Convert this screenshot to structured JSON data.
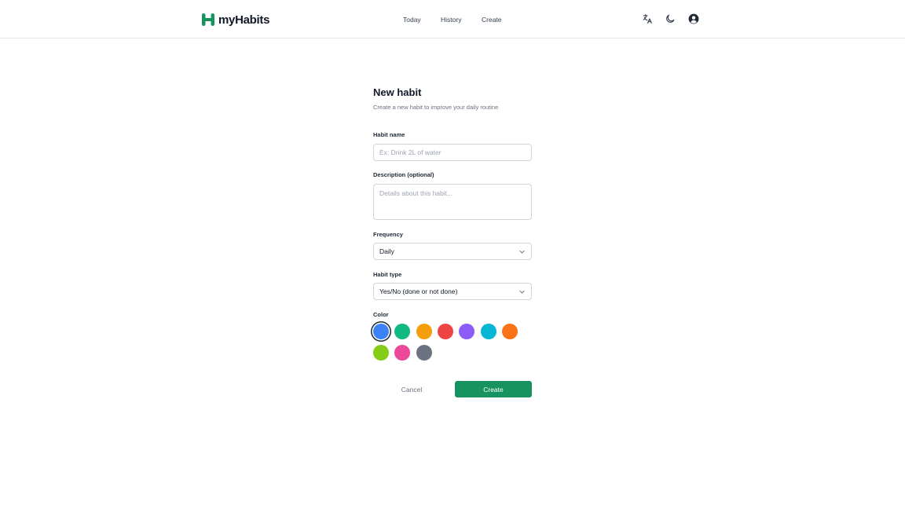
{
  "header": {
    "logo_text": "myHabits",
    "nav": {
      "today": "Today",
      "history": "History",
      "create": "Create"
    },
    "icons": [
      "translate-icon",
      "moon-icon",
      "user-avatar-icon"
    ]
  },
  "form": {
    "title": "New habit",
    "subtitle": "Create a new habit to improve your daily routine",
    "name_label": "Habit name",
    "name_placeholder": "Ex: Drink 2L of water",
    "description_label": "Description (optional)",
    "description_placeholder": "Details about this habit...",
    "frequency_label": "Frequency",
    "frequency_value": "Daily",
    "type_label": "Habit type",
    "type_value": "Yes/No (done or not done)",
    "color_label": "Color",
    "colors": [
      "#3b82f6",
      "#10b981",
      "#f59e0b",
      "#ef4444",
      "#8b5cf6",
      "#06b6d4",
      "#f97316",
      "#84cc16",
      "#ec4899",
      "#6b7280"
    ],
    "selected_color": "#3b82f6",
    "cancel_label": "Cancel",
    "create_label": "Create"
  },
  "theme": {
    "accent": "#16935f"
  }
}
